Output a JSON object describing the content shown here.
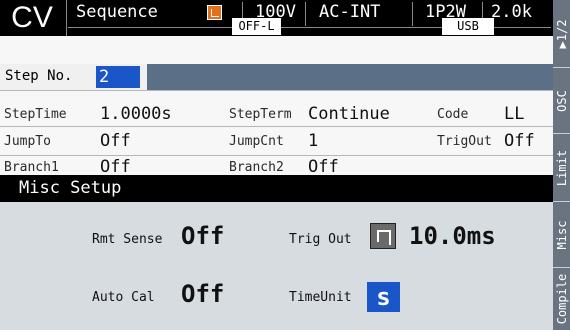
{
  "header": {
    "mode": "CV",
    "menu": "Sequence",
    "ovp_icon": "output-protect-icon",
    "voltage_range": "100V",
    "source": "AC-INT",
    "phase": "1P2W",
    "freq_range": "2.0k",
    "output_state": "OFF-L",
    "interface": "USB"
  },
  "side_tabs": [
    "▶1/2",
    "OSC",
    "Limit",
    "Misc",
    "Compile"
  ],
  "step": {
    "label": "Step No.",
    "value": "2"
  },
  "params": {
    "step_time_label": "StepTime",
    "step_time_value": "1.0000s",
    "step_term_label": "StepTerm",
    "step_term_value": "Continue",
    "code_label": "Code",
    "code_value": "LL",
    "jump_to_label": "JumpTo",
    "jump_to_value": "Off",
    "jump_cnt_label": "JumpCnt",
    "jump_cnt_value": "1",
    "trig_out_label": "TrigOut",
    "trig_out_value": "Off",
    "branch1_label": "Branch1",
    "branch1_value": "Off",
    "branch2_label": "Branch2",
    "branch2_value": "Off"
  },
  "dialog": {
    "title": "Misc Setup",
    "rmt_sense_label": "Rmt Sense",
    "rmt_sense_value": "Off",
    "trig_out_label": "Trig Out",
    "trig_out_value": "10.0ms",
    "auto_cal_label": "Auto Cal",
    "auto_cal_value": "Off",
    "time_unit_label": "TimeUnit",
    "time_unit_value": "s"
  },
  "colors": {
    "accent": "#1b56c8",
    "header_bg": "#000000",
    "strip": "#5b6f87",
    "side_tab": "#6a7480",
    "dialog_bg": "#d7dce1",
    "ovp_icon": "#e0701c"
  }
}
